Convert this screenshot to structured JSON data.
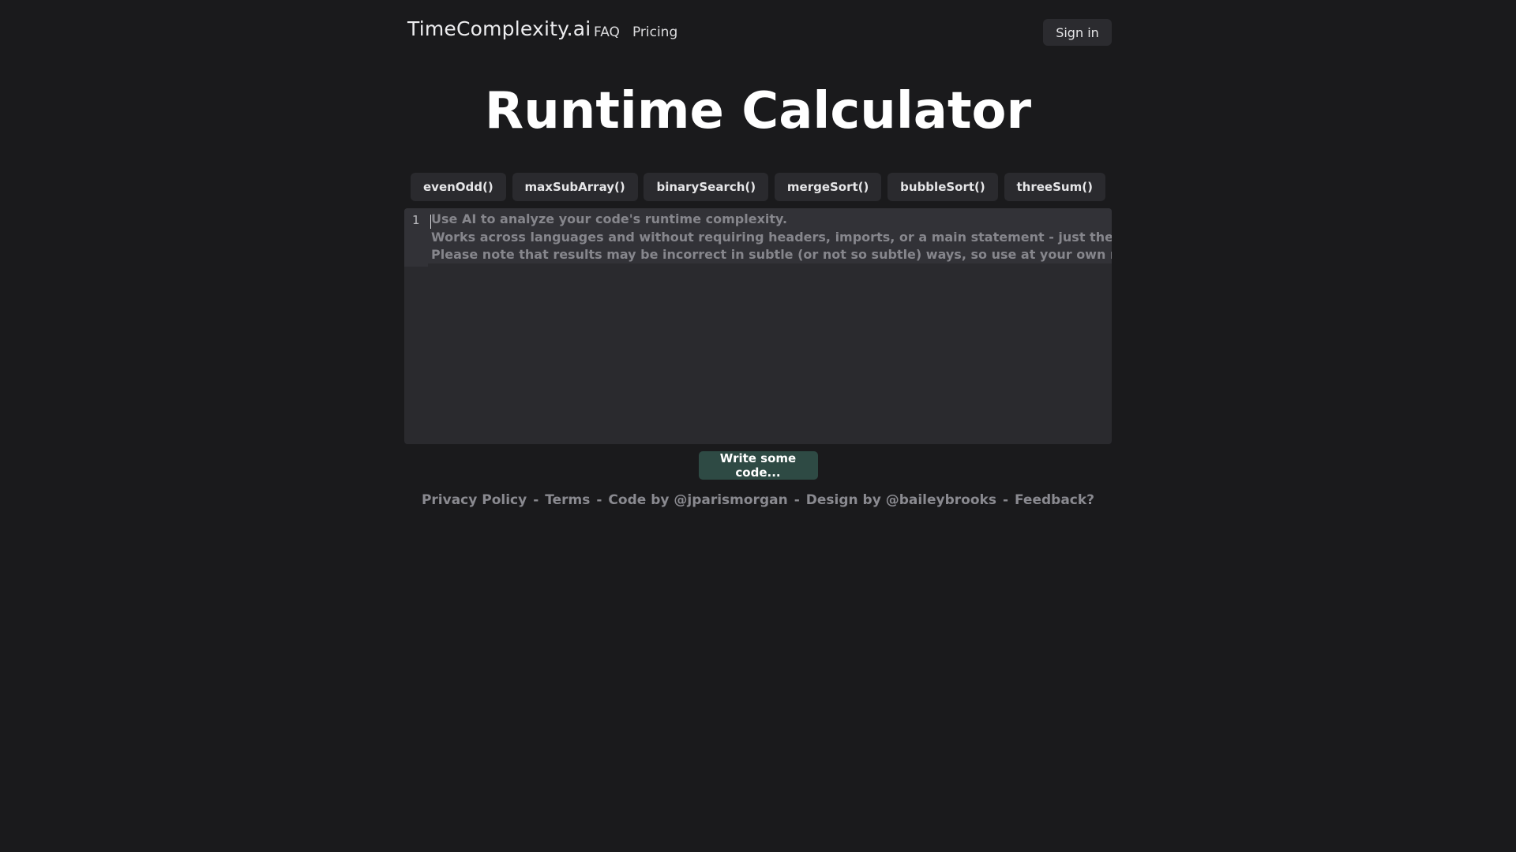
{
  "header": {
    "brand": "TimeComplexity.ai",
    "nav": [
      "FAQ",
      "Pricing"
    ],
    "sign_in_label": "Sign in"
  },
  "main": {
    "title": "Runtime Calculator",
    "examples": [
      "evenOdd()",
      "maxSubArray()",
      "binarySearch()",
      "mergeSort()",
      "bubbleSort()",
      "threeSum()"
    ],
    "editor": {
      "line_number": "1",
      "placeholder_lines": [
        "Use AI to analyze your code's runtime complexity.",
        "Works across languages and without requiring headers, imports, or a main statement - just the code itself.",
        "Please note that results may be incorrect in subtle (or not so subtle) ways, so use at your own risk!"
      ]
    },
    "submit_label": "Write some code..."
  },
  "footer": {
    "links": [
      "Privacy Policy",
      "Terms",
      "Code by @jparismorgan",
      "Design by @baileybrooks",
      "Feedback?"
    ],
    "separator": "-"
  }
}
